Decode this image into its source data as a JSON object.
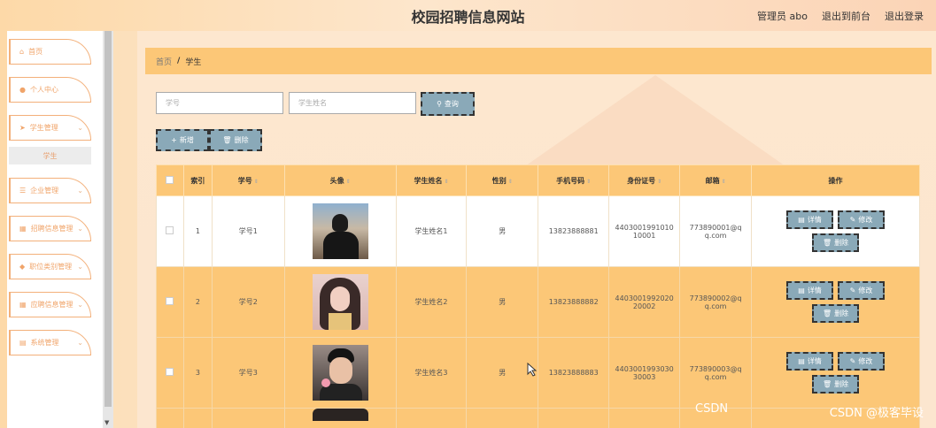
{
  "header": {
    "title": "校园招聘信息网站",
    "links": [
      "管理员 abo",
      "退出到前台",
      "退出登录"
    ]
  },
  "sidebar": {
    "items": [
      {
        "icon": "home-icon",
        "label": "首页"
      },
      {
        "icon": "user-icon",
        "label": "个人中心"
      },
      {
        "icon": "send-icon",
        "label": "学生管理"
      },
      {
        "icon": "sliders-icon",
        "label": "企业管理"
      },
      {
        "icon": "grid-icon",
        "label": "招聘信息管理"
      },
      {
        "icon": "tag-icon",
        "label": "职位类别管理"
      },
      {
        "icon": "grid-icon",
        "label": "应聘信息管理"
      },
      {
        "icon": "list-icon",
        "label": "系统管理"
      }
    ],
    "submenu": "学生"
  },
  "breadcrumb": {
    "home": "首页",
    "sep": "/",
    "current": "学生"
  },
  "search": {
    "student_id_placeholder": "学号",
    "student_name_placeholder": "学生姓名",
    "query_label": "查询"
  },
  "actions": {
    "add_label": "新增",
    "delete_label": "删除"
  },
  "table": {
    "headers": [
      "索引",
      "学号",
      "头像",
      "学生姓名",
      "性别",
      "手机号码",
      "身份证号",
      "邮箱",
      "操作"
    ],
    "rows": [
      {
        "index": "1",
        "id": "学号1",
        "name": "学生姓名1",
        "gender": "男",
        "phone": "13823888881",
        "idcard1": "4403001991010",
        "idcard2": "10001",
        "email1": "773890001@q",
        "email2": "q.com"
      },
      {
        "index": "2",
        "id": "学号2",
        "name": "学生姓名2",
        "gender": "男",
        "phone": "13823888882",
        "idcard1": "4403001992020",
        "idcard2": "20002",
        "email1": "773890002@q",
        "email2": "q.com"
      },
      {
        "index": "3",
        "id": "学号3",
        "name": "学生姓名3",
        "gender": "男",
        "phone": "13823888883",
        "idcard1": "4403001993030",
        "idcard2": "30003",
        "email1": "773890003@q",
        "email2": "q.com"
      }
    ],
    "ops": {
      "detail": "详情",
      "edit": "修改",
      "delete": "删除"
    }
  },
  "watermark": {
    "text": "CSDN @极客毕设",
    "small": "CSDN"
  }
}
